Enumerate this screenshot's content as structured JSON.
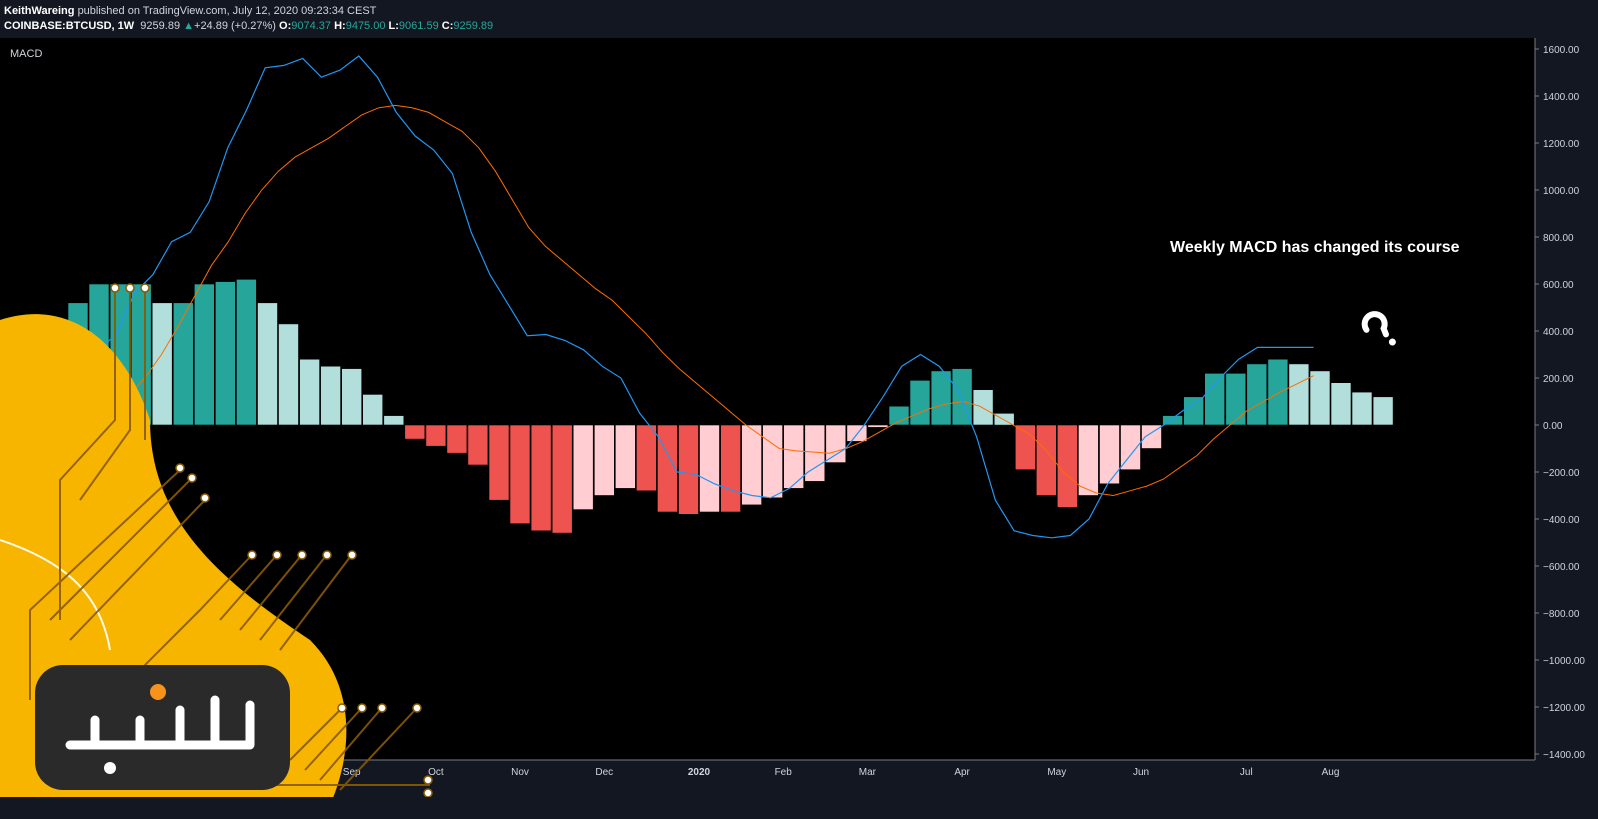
{
  "header": {
    "author": "KeithWareing",
    "published_text": "published on TradingView.com, July 12, 2020 09:23:34 CEST",
    "symbol": "COINBASE:BTCUSD, 1W",
    "price": "9259.89",
    "change_arrow": "▲",
    "change": "+24.89 (+0.27%)",
    "open_label": "O:",
    "open": "9074.37",
    "high_label": "H:",
    "high": "9475.00",
    "low_label": "L:",
    "low": "9061.59",
    "close_label": "C:",
    "close": "9259.89"
  },
  "chart_data": {
    "type": "line",
    "title": "MACD",
    "annotation": "Weekly MACD has changed its course",
    "y_ticks": [
      "1600.00",
      "1400.00",
      "1200.00",
      "1000.00",
      "800.00",
      "600.00",
      "400.00",
      "200.00",
      "0.00",
      "−200.00",
      "−400.00",
      "−600.00",
      "−800.00",
      "−1000.00",
      "−1200.00",
      "−1400.00"
    ],
    "ylim": [
      -1400,
      1600
    ],
    "x_ticks": [
      {
        "label": "Aug",
        "week": 12
      },
      {
        "label": "Sep",
        "week": 16
      },
      {
        "label": "Oct",
        "week": 20
      },
      {
        "label": "Nov",
        "week": 24
      },
      {
        "label": "Dec",
        "week": 28
      },
      {
        "label": "2020",
        "week": 32.5
      },
      {
        "label": "Feb",
        "week": 36.5
      },
      {
        "label": "Mar",
        "week": 40.5
      },
      {
        "label": "Apr",
        "week": 45
      },
      {
        "label": "May",
        "week": 49.5
      },
      {
        "label": "Jun",
        "week": 53.5
      },
      {
        "label": "Jul",
        "week": 58.5
      },
      {
        "label": "Aug",
        "week": 62.5
      }
    ],
    "weeks": [
      0,
      1,
      2,
      3,
      4,
      5,
      6,
      7,
      8,
      9,
      10,
      11,
      12,
      13,
      14,
      15,
      16,
      17,
      18,
      19,
      20,
      21,
      22,
      23,
      24,
      25,
      26,
      27,
      28,
      29,
      30,
      31,
      32,
      33,
      34,
      35,
      36,
      37,
      38,
      39,
      40,
      41,
      42,
      43,
      44,
      45,
      46,
      47,
      48,
      49,
      50,
      51,
      52,
      53,
      54,
      55,
      56,
      57,
      58
    ],
    "colors": {
      "macd": "#2196f3",
      "signal": "#ff6d00",
      "hist_pos_grow": "#26a69a",
      "hist_pos_fall": "#b2dfdb",
      "hist_neg_grow": "#ef5350",
      "hist_neg_fall": "#ffcdd2",
      "background": "#000000"
    },
    "series": [
      {
        "key": "macd",
        "values": [
          180,
          320,
          380,
          560,
          640,
          780,
          820,
          950,
          1180,
          1340,
          1520,
          1530,
          1560,
          1480,
          1510,
          1570,
          1480,
          1330,
          1230,
          1170,
          1070,
          820,
          640,
          510,
          380,
          385,
          360,
          320,
          250,
          200,
          50,
          -50,
          -200,
          -210,
          -250,
          -280,
          -300,
          -310,
          -270,
          -200,
          -150,
          -100,
          0,
          120,
          250,
          300,
          250,
          150,
          -50,
          -320,
          -450,
          -470,
          -480,
          -470,
          -400,
          -250,
          -150,
          -50,
          0,
          60,
          110,
          200,
          280,
          330,
          330,
          330,
          330
        ]
      },
      {
        "key": "signal",
        "values": [
          -20,
          20,
          60,
          120,
          200,
          300,
          420,
          550,
          680,
          780,
          900,
          1000,
          1080,
          1140,
          1180,
          1220,
          1270,
          1320,
          1350,
          1360,
          1350,
          1330,
          1290,
          1250,
          1180,
          1080,
          960,
          840,
          760,
          700,
          640,
          580,
          530,
          460,
          390,
          310,
          240,
          180,
          120,
          60,
          0,
          -50,
          -100,
          -110,
          -115,
          -120,
          -100,
          -70,
          -30,
          10,
          40,
          70,
          90,
          100,
          80,
          40,
          0,
          -40,
          -110,
          -200,
          -260,
          -290,
          -300,
          -280,
          -260,
          -230,
          -180,
          -130,
          -60,
          0,
          60,
          100,
          140,
          175,
          210
        ]
      }
    ],
    "histogram": {
      "start_week": 3,
      "values": [
        520,
        600,
        600,
        600,
        520,
        520,
        600,
        610,
        620,
        520,
        430,
        280,
        250,
        240,
        130,
        40,
        -60,
        -90,
        -120,
        -170,
        -320,
        -420,
        -450,
        -460,
        -360,
        -300,
        -270,
        -280,
        -370,
        -380,
        -370,
        -370,
        -340,
        -310,
        -270,
        -240,
        -160,
        -70,
        -10,
        80,
        190,
        230,
        240,
        150,
        50,
        -190,
        -300,
        -350,
        -300,
        -250,
        -190,
        -100,
        40,
        120,
        220,
        220,
        260,
        280,
        260,
        230,
        180,
        140,
        120
      ]
    }
  }
}
